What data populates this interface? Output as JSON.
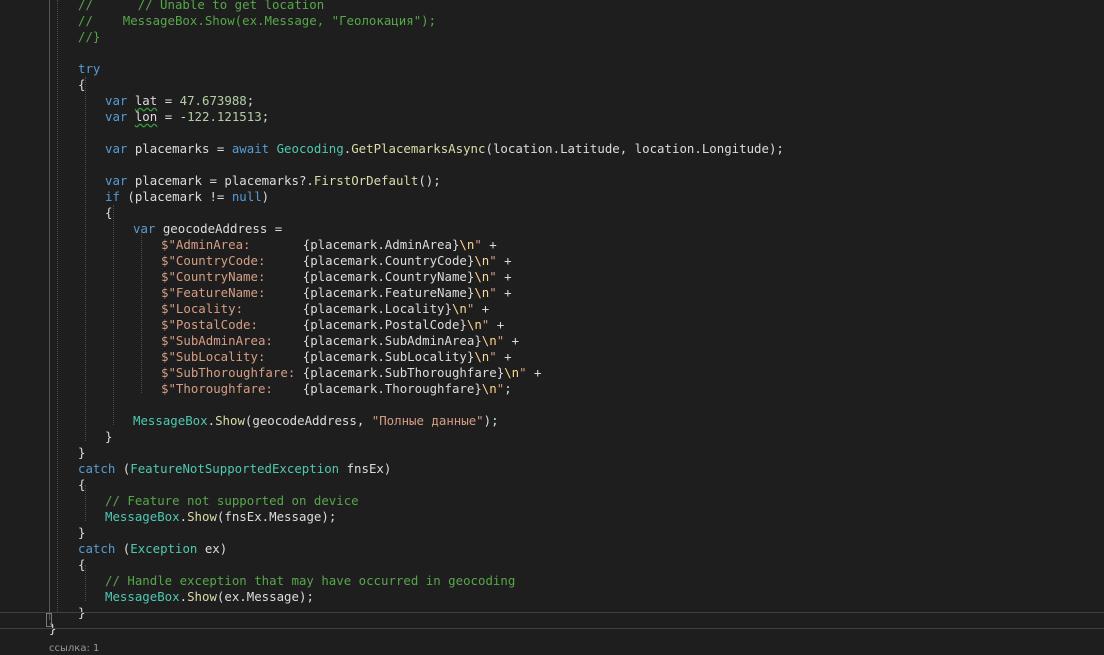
{
  "codelens": "ссылка: 1",
  "lines": [
    [
      [
        "cm",
        "//      // Unable to get location"
      ]
    ],
    [
      [
        "cm",
        "//    MessageBox.Show(ex.Message, \"Геолокация\");"
      ]
    ],
    [
      [
        "cm",
        "//}"
      ]
    ],
    [],
    [
      [
        "kw",
        "try"
      ]
    ],
    [
      [
        "pl",
        "{"
      ]
    ],
    [
      [
        "kw",
        "var "
      ],
      [
        "sq",
        "lat"
      ],
      [
        "pl",
        " = "
      ],
      [
        "num",
        "47.673988"
      ],
      [
        "pl",
        ";"
      ]
    ],
    [
      [
        "kw",
        "var "
      ],
      [
        "sq",
        "lon"
      ],
      [
        "pl",
        " = -"
      ],
      [
        "num",
        "122.121513"
      ],
      [
        "pl",
        ";"
      ]
    ],
    [],
    [
      [
        "kw",
        "var "
      ],
      [
        "pl",
        "placemarks = "
      ],
      [
        "kw",
        "await "
      ],
      [
        "ty",
        "Geocoding"
      ],
      [
        "pl",
        "."
      ],
      [
        "fn",
        "GetPlacemarksAsync"
      ],
      [
        "pl",
        "(location.Latitude, location.Longitude);"
      ]
    ],
    [],
    [
      [
        "kw",
        "var "
      ],
      [
        "pl",
        "placemark = placemarks?."
      ],
      [
        "fn",
        "FirstOrDefault"
      ],
      [
        "pl",
        "();"
      ]
    ],
    [
      [
        "kw",
        "if "
      ],
      [
        "pl",
        "(placemark != "
      ],
      [
        "kw",
        "null"
      ],
      [
        "pl",
        ")"
      ]
    ],
    [
      [
        "pl",
        "{"
      ]
    ],
    [
      [
        "kw",
        "var "
      ],
      [
        "pl",
        "geocodeAddress ="
      ]
    ],
    [
      [
        "str",
        "$\"AdminArea:       "
      ],
      [
        "pl",
        "{placemark.AdminArea}"
      ],
      [
        "esc",
        "\\n"
      ],
      [
        "str",
        "\""
      ],
      [
        "pl",
        " +"
      ]
    ],
    [
      [
        "str",
        "$\"CountryCode:     "
      ],
      [
        "pl",
        "{placemark.CountryCode}"
      ],
      [
        "esc",
        "\\n"
      ],
      [
        "str",
        "\""
      ],
      [
        "pl",
        " +"
      ]
    ],
    [
      [
        "str",
        "$\"CountryName:     "
      ],
      [
        "pl",
        "{placemark.CountryName}"
      ],
      [
        "esc",
        "\\n"
      ],
      [
        "str",
        "\""
      ],
      [
        "pl",
        " +"
      ]
    ],
    [
      [
        "str",
        "$\"FeatureName:     "
      ],
      [
        "pl",
        "{placemark.FeatureName}"
      ],
      [
        "esc",
        "\\n"
      ],
      [
        "str",
        "\""
      ],
      [
        "pl",
        " +"
      ]
    ],
    [
      [
        "str",
        "$\"Locality:        "
      ],
      [
        "pl",
        "{placemark.Locality}"
      ],
      [
        "esc",
        "\\n"
      ],
      [
        "str",
        "\""
      ],
      [
        "pl",
        " +"
      ]
    ],
    [
      [
        "str",
        "$\"PostalCode:      "
      ],
      [
        "pl",
        "{placemark.PostalCode}"
      ],
      [
        "esc",
        "\\n"
      ],
      [
        "str",
        "\""
      ],
      [
        "pl",
        " +"
      ]
    ],
    [
      [
        "str",
        "$\"SubAdminArea:    "
      ],
      [
        "pl",
        "{placemark.SubAdminArea}"
      ],
      [
        "esc",
        "\\n"
      ],
      [
        "str",
        "\""
      ],
      [
        "pl",
        " +"
      ]
    ],
    [
      [
        "str",
        "$\"SubLocality:     "
      ],
      [
        "pl",
        "{placemark.SubLocality}"
      ],
      [
        "esc",
        "\\n"
      ],
      [
        "str",
        "\""
      ],
      [
        "pl",
        " +"
      ]
    ],
    [
      [
        "str",
        "$\"SubThoroughfare: "
      ],
      [
        "pl",
        "{placemark.SubThoroughfare}"
      ],
      [
        "esc",
        "\\n"
      ],
      [
        "str",
        "\""
      ],
      [
        "pl",
        " +"
      ]
    ],
    [
      [
        "str",
        "$\"Thoroughfare:    "
      ],
      [
        "pl",
        "{placemark.Thoroughfare}"
      ],
      [
        "esc",
        "\\n"
      ],
      [
        "str",
        "\""
      ],
      [
        "pl",
        ";"
      ]
    ],
    [],
    [
      [
        "ty",
        "MessageBox"
      ],
      [
        "pl",
        "."
      ],
      [
        "fn",
        "Show"
      ],
      [
        "pl",
        "(geocodeAddress, "
      ],
      [
        "str",
        "\"Полные данные\""
      ],
      [
        "pl",
        ");"
      ]
    ],
    [
      [
        "pl",
        "}"
      ]
    ],
    [
      [
        "pl",
        "}"
      ]
    ],
    [
      [
        "kw",
        "catch "
      ],
      [
        "pl",
        "("
      ],
      [
        "ty",
        "FeatureNotSupportedException"
      ],
      [
        "pl",
        " fnsEx)"
      ]
    ],
    [
      [
        "pl",
        "{"
      ]
    ],
    [
      [
        "cm",
        "// Feature not supported on device"
      ]
    ],
    [
      [
        "ty",
        "MessageBox"
      ],
      [
        "pl",
        "."
      ],
      [
        "fn",
        "Show"
      ],
      [
        "pl",
        "(fnsEx.Message);"
      ]
    ],
    [
      [
        "pl",
        "}"
      ]
    ],
    [
      [
        "kw",
        "catch "
      ],
      [
        "pl",
        "("
      ],
      [
        "ty",
        "Exception"
      ],
      [
        "pl",
        " ex)"
      ]
    ],
    [
      [
        "pl",
        "{"
      ]
    ],
    [
      [
        "cm",
        "// Handle exception that may have occurred in geocoding"
      ]
    ],
    [
      [
        "ty",
        "MessageBox"
      ],
      [
        "pl",
        "."
      ],
      [
        "fn",
        "Show"
      ],
      [
        "pl",
        "(ex.Message);"
      ]
    ],
    [
      [
        "pl",
        "}"
      ]
    ],
    [
      [
        "pl",
        "}"
      ]
    ]
  ]
}
